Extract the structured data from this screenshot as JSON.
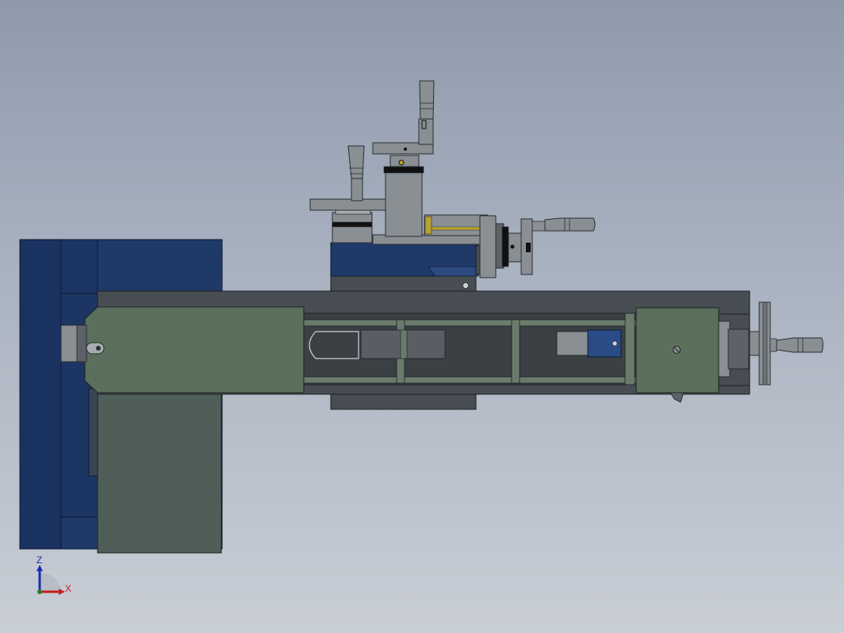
{
  "view": {
    "type": "cad-side-view",
    "background_top": "#8e9aac",
    "background_bottom": "#c9ced6"
  },
  "colors": {
    "steel_blue": "#1f3a68",
    "steel_blue_dark": "#1a3260",
    "machine_green": "#5a6f5c",
    "green_gray": "#4f5e58",
    "dark_frame": "#474d52",
    "metal_gray": "#8a8f94",
    "metal_dark": "#5d6268",
    "metal_light": "#a7abb0",
    "accent_yellow": "#b7a233",
    "accent_black": "#111111"
  },
  "triad": {
    "z_label": "Z",
    "x_label": "X",
    "z_color": "#1a2fb0",
    "x_color": "#c0201f"
  }
}
